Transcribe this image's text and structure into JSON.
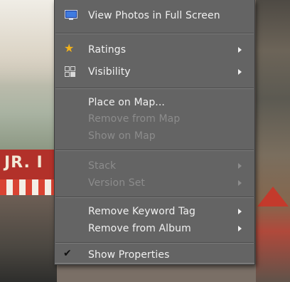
{
  "menu": {
    "items": [
      {
        "id": "view-full-screen",
        "label": "View Photos in Full Screen",
        "enabled": true,
        "icon": "monitor-icon",
        "submenu": false
      },
      {
        "id": "ratings",
        "label": "Ratings",
        "enabled": true,
        "icon": "star-icon",
        "submenu": true
      },
      {
        "id": "visibility",
        "label": "Visibility",
        "enabled": true,
        "icon": "grid-icon",
        "submenu": true
      },
      {
        "id": "place-on-map",
        "label": "Place on Map...",
        "enabled": true,
        "submenu": false
      },
      {
        "id": "remove-from-map",
        "label": "Remove from Map",
        "enabled": false,
        "submenu": false
      },
      {
        "id": "show-on-map",
        "label": "Show on Map",
        "enabled": false,
        "submenu": false
      },
      {
        "id": "stack",
        "label": "Stack",
        "enabled": false,
        "submenu": true
      },
      {
        "id": "version-set",
        "label": "Version Set",
        "enabled": false,
        "submenu": true
      },
      {
        "id": "remove-keyword-tag",
        "label": "Remove Keyword Tag",
        "enabled": true,
        "submenu": true
      },
      {
        "id": "remove-from-album",
        "label": "Remove from Album",
        "enabled": true,
        "submenu": true
      },
      {
        "id": "show-properties",
        "label": "Show Properties",
        "enabled": true,
        "checked": true,
        "icon": "check-icon",
        "submenu": false
      }
    ]
  },
  "background": {
    "sign_text": "JR. I"
  },
  "colors": {
    "menu_bg": "#646464",
    "text_enabled": "#f1f1f1",
    "text_disabled": "#8c8c8c",
    "star": "#f2b21a"
  }
}
